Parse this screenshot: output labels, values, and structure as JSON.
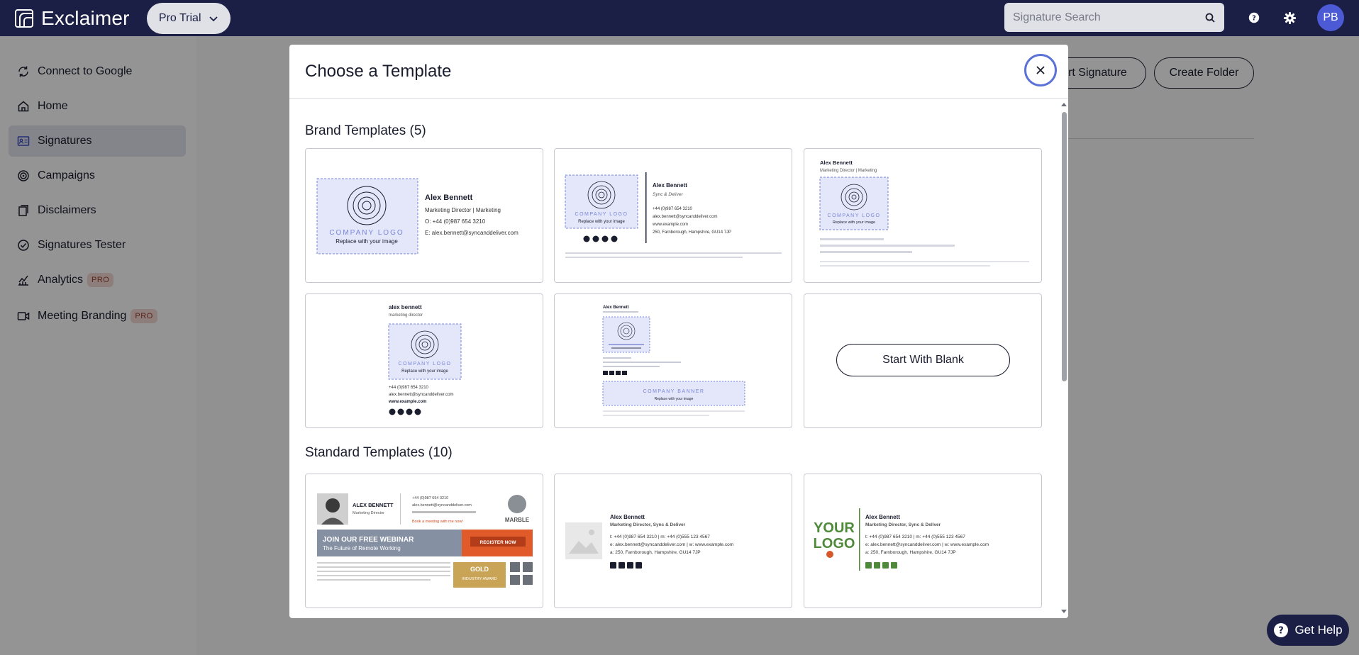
{
  "app": {
    "name": "Exclaimer",
    "plan": "Pro Trial",
    "user_initials": "PB"
  },
  "search": {
    "placeholder": "Signature Search"
  },
  "sidebar": {
    "items": [
      {
        "label": "Connect to Google",
        "icon": "refresh-icon"
      },
      {
        "label": "Home",
        "icon": "home-icon"
      },
      {
        "label": "Signatures",
        "icon": "id-card-icon",
        "active": true
      },
      {
        "label": "Campaigns",
        "icon": "target-icon"
      },
      {
        "label": "Disclaimers",
        "icon": "documents-icon"
      },
      {
        "label": "Signatures Tester",
        "icon": "check-circle-icon"
      },
      {
        "label": "Analytics",
        "icon": "chart-icon",
        "badge": "PRO"
      },
      {
        "label": "Meeting Branding",
        "icon": "video-icon",
        "badge": "PRO"
      }
    ]
  },
  "background": {
    "import_label": "ort Signature",
    "create_folder_label": "Create Folder"
  },
  "modal": {
    "title": "Choose a Template",
    "brand_section": "Brand Templates (5)",
    "standard_section": "Standard Templates (10)",
    "start_blank": "Start With Blank"
  },
  "thumb": {
    "name": "Alex Bennett",
    "name_lower": "alex bennett",
    "role": "Marketing Director",
    "role_pipe": "Marketing Director | Marketing",
    "role_lower": "marketing director",
    "company_tag": "Sync & Deliver",
    "role_company": "Marketing Director, Sync & Deliver",
    "phone_line": "O: +44 (0)987 654 3210",
    "email_line": "E: alex.bennett@syncanddeliver.com",
    "logo_text": "COMPANY LOGO",
    "replace_text": "Replace with your image",
    "banner_text": "COMPANY BANNER",
    "phone": "+44 (0)987 654 3210",
    "email": "alex.bennett@syncanddeliver.com",
    "web": "www.example.com",
    "address": "250, Farnborough, Hampshire, GU14 7JP",
    "phone_multi": "t: +44 (0)987 654 3210 | m: +44 (0)555 123 4567",
    "email_multi": "e: alex.bennett@syncanddeliver.com | w: www.example.com",
    "address_multi": "a: 250, Farnborough, Hampshire, GU14 7JP",
    "name_caps": "ALEX BENNETT",
    "webinar_title": "JOIN OUR FREE WEBINAR",
    "webinar_sub": "The Future of Remote Working",
    "register": "REGISTER NOW",
    "marble": "MARBLE",
    "gold": "GOLD",
    "award": "INDUSTRY AWARD",
    "your": "YOUR",
    "logo": "LOGO",
    "meeting": "Book a meeting with me now!"
  },
  "help": {
    "label": "Get Help"
  },
  "colors": {
    "navy": "#1b1f45",
    "accent": "#5b73d6",
    "pro_badge": "#f3d9d4"
  }
}
